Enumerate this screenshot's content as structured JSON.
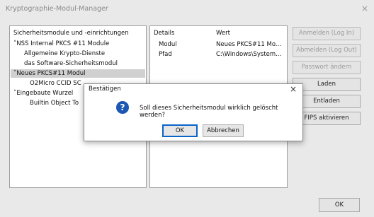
{
  "window": {
    "title": "Kryptographie-Modul-Manager",
    "close_glyph": "×"
  },
  "tree": {
    "header": "Sicherheitsmodule und -einrichtungen",
    "items": [
      {
        "text": "˅NSS Internal PKCS #11 Module",
        "selected": false
      },
      {
        "text": "Allgemeine Krypto-Dienste",
        "selected": false
      },
      {
        "text": "das Software-Sicherheitsmodul",
        "selected": false
      },
      {
        "text": "˅Neues PKCS#11 Modul",
        "selected": true
      },
      {
        "text": "O2Micro CCID SC",
        "selected": false
      },
      {
        "text": "˅Eingebaute Wurzel",
        "selected": false
      },
      {
        "text": "Builtin Object To",
        "selected": false
      }
    ]
  },
  "details": {
    "col_details": "Details",
    "col_value": "Wert",
    "rows": [
      {
        "key": "Modul",
        "value": "Neues PKCS#11 Mo..."
      },
      {
        "key": "Pfad",
        "value": "C:\\Windows\\System..."
      }
    ]
  },
  "buttons": {
    "login": "Anmelden (Log In)",
    "logout": "Abmelden (Log Out)",
    "password": "Passwort ändern",
    "load": "Laden",
    "unload": "Entladen",
    "fips": "FIPS aktivieren",
    "ok": "OK"
  },
  "dialog": {
    "title": "Bestätigen",
    "close_glyph": "×",
    "icon": "question-icon",
    "icon_glyph": "?",
    "message": "Soll dieses Sicherheitsmodul wirklich gelöscht werden?",
    "ok": "OK",
    "cancel": "Abbrechen"
  },
  "colors": {
    "icon_blue": "#1b57b3",
    "focus_border": "#0a64c8",
    "selection": "#d0d0d0"
  }
}
